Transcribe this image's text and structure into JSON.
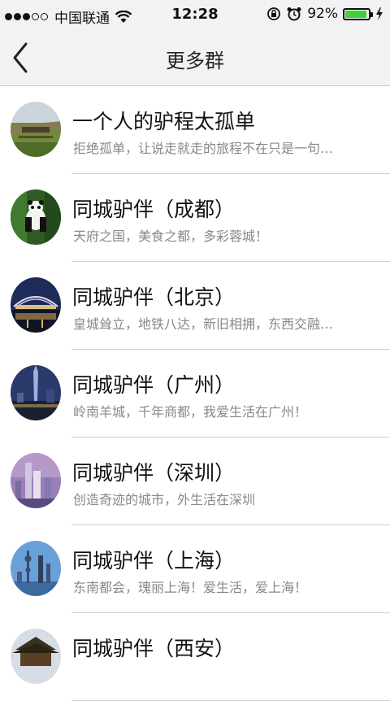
{
  "status_bar": {
    "signal_dots": [
      true,
      true,
      true,
      false,
      false
    ],
    "carrier": "中国联通",
    "time": "12:28",
    "battery_pct": "92%",
    "battery_level": 0.92,
    "battery_color": "#3fd13a"
  },
  "nav": {
    "title": "更多群",
    "back_icon": "chevron-left-icon"
  },
  "groups": [
    {
      "title": "一个人的驴程太孤单",
      "subtitle": "拒绝孤单，让说走就走的旅程不在只是一句…",
      "avatar": "train-landscape"
    },
    {
      "title": "同城驴伴（成都）",
      "subtitle": "天府之国，美食之都，多彩蓉城！",
      "avatar": "panda"
    },
    {
      "title": "同城驴伴（北京）",
      "subtitle": "皇城耸立，地铁八达，新旧相拥，东西交融…",
      "avatar": "night-stadium"
    },
    {
      "title": "同城驴伴（广州）",
      "subtitle": "岭南羊城，千年商都，我爱生活在广州！",
      "avatar": "night-tower"
    },
    {
      "title": "同城驴伴（深圳）",
      "subtitle": "创造奇迹的城市，外生活在深圳",
      "avatar": "skyline-dusk"
    },
    {
      "title": "同城驴伴（上海）",
      "subtitle": "东南都会，瑰丽上海！爱生活，爱上海！",
      "avatar": "skyline-blue"
    },
    {
      "title": "同城驴伴（西安）",
      "subtitle": "",
      "avatar": "pagoda"
    }
  ],
  "colors": {
    "bar_bg": "#f2f2f2",
    "separator": "#cfcfcf",
    "subtitle": "#888888"
  }
}
